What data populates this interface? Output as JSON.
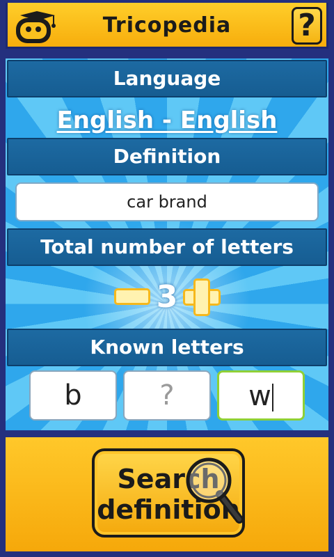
{
  "header": {
    "title": "Tricopedia",
    "logo_icon": "robot-graduate-icon",
    "help_icon": "question-mark-icon",
    "help_label": "?"
  },
  "language": {
    "heading": "Language",
    "value": "English - English"
  },
  "definition": {
    "heading": "Definition",
    "value": "car brand"
  },
  "letters_count": {
    "heading": "Total number of letters",
    "value": "3",
    "minus_icon": "minus-icon",
    "plus_icon": "plus-icon"
  },
  "known_letters": {
    "heading": "Known letters",
    "boxes": [
      {
        "value": "b"
      },
      {
        "value": "",
        "placeholder": "?"
      },
      {
        "value": "w"
      }
    ]
  },
  "search_button": {
    "line1": "Search",
    "line2": "definition",
    "icon": "magnifier-icon"
  },
  "colors": {
    "accent_yellow": "#f7ad0c",
    "header_blue": "#1d6aa2",
    "background_navy": "#24307e",
    "ray_light": "#5fc8f6",
    "ray_dark": "#2fa7ec",
    "active_border": "#8fd036"
  }
}
